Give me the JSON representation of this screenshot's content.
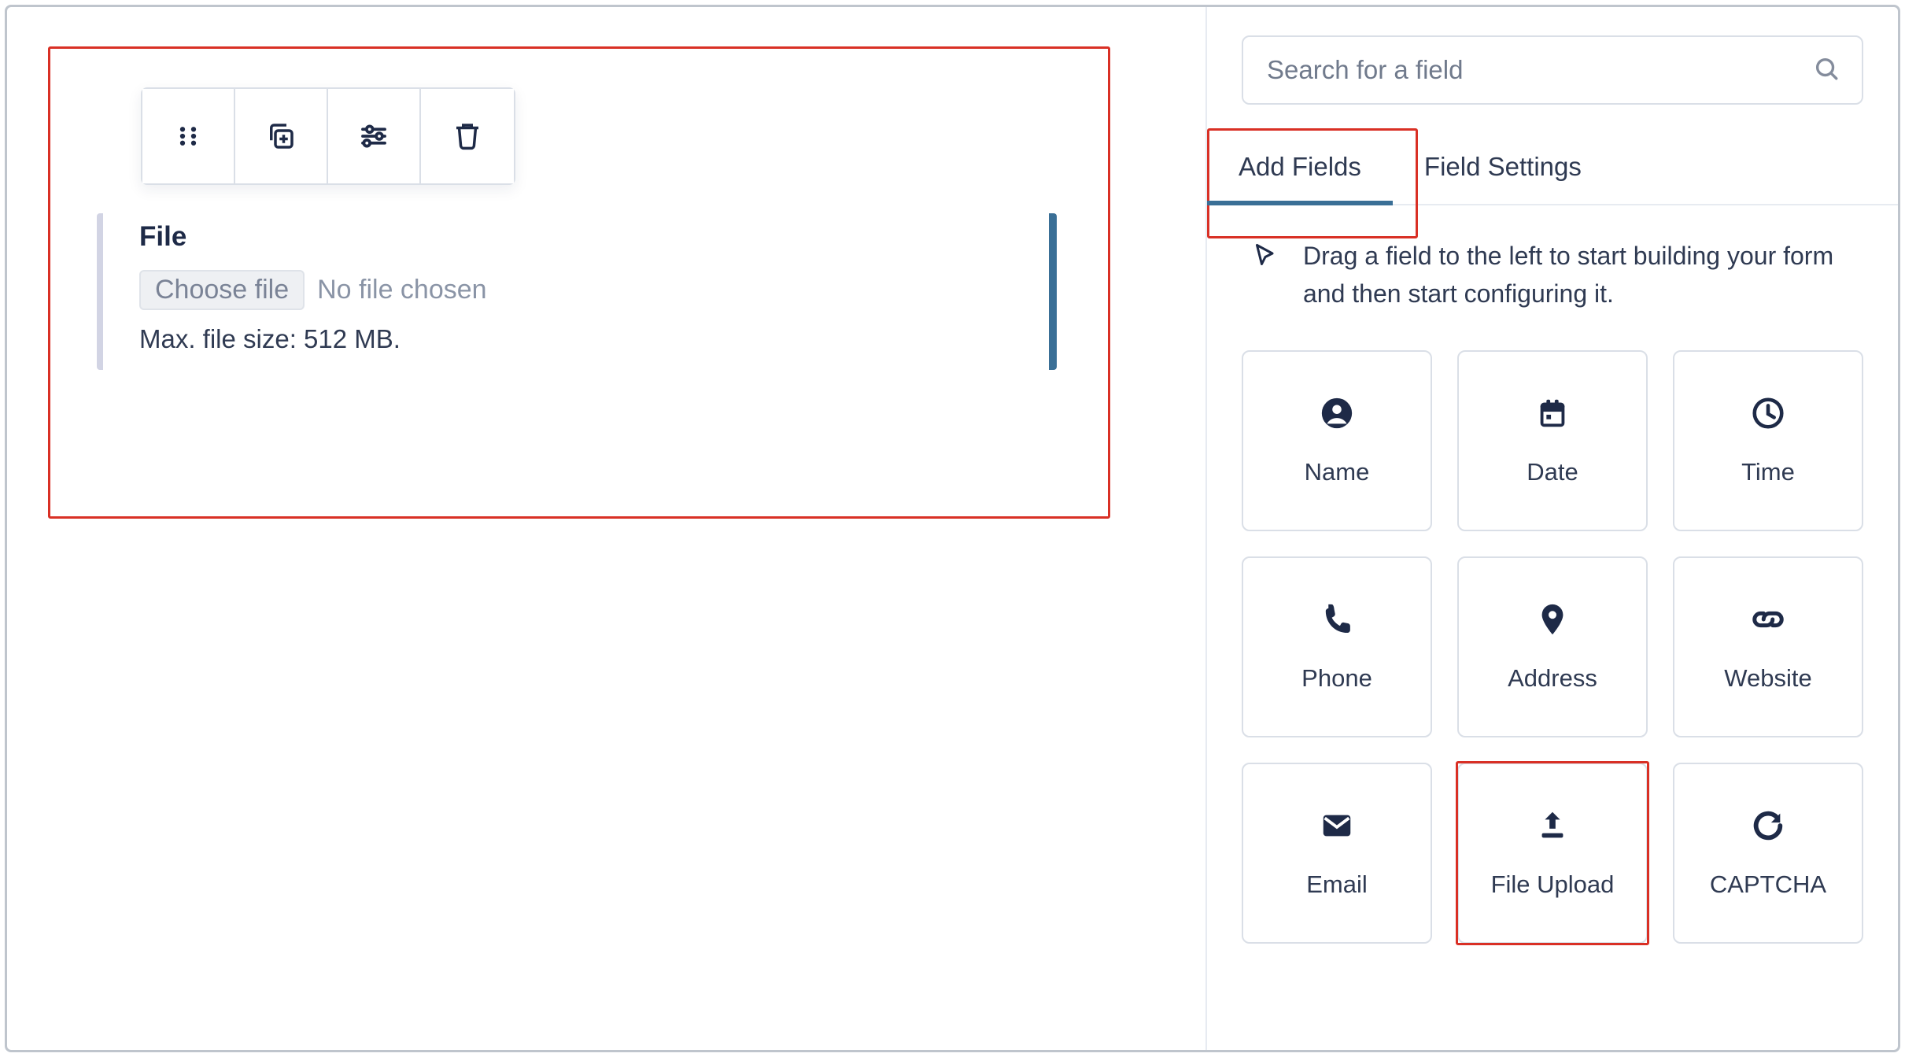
{
  "canvas": {
    "field_label": "File",
    "choose_button": "Choose file",
    "no_file_text": "No file chosen",
    "help_text": "Max. file size: 512 MB."
  },
  "search": {
    "placeholder": "Search for a field"
  },
  "tabs": [
    {
      "key": "add",
      "label": "Add Fields",
      "active": true
    },
    {
      "key": "settings",
      "label": "Field Settings",
      "active": false
    }
  ],
  "hint": "Drag a field to the left to start building your form and then start configuring it.",
  "fields": [
    {
      "key": "name",
      "label": "Name",
      "icon": "person"
    },
    {
      "key": "date",
      "label": "Date",
      "icon": "calendar"
    },
    {
      "key": "time",
      "label": "Time",
      "icon": "clock"
    },
    {
      "key": "phone",
      "label": "Phone",
      "icon": "phone"
    },
    {
      "key": "address",
      "label": "Address",
      "icon": "pin"
    },
    {
      "key": "website",
      "label": "Website",
      "icon": "link"
    },
    {
      "key": "email",
      "label": "Email",
      "icon": "mail"
    },
    {
      "key": "file-upload",
      "label": "File Upload",
      "icon": "upload",
      "highlighted": true
    },
    {
      "key": "captcha",
      "label": "CAPTCHA",
      "icon": "refresh"
    }
  ],
  "colors": {
    "accent": "#3a6f96",
    "highlight": "#d93025"
  }
}
